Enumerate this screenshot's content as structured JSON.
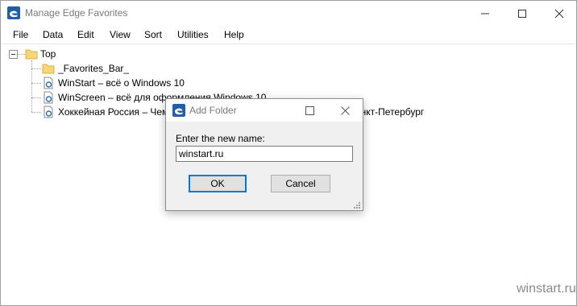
{
  "window": {
    "title": "Manage Edge Favorites"
  },
  "menu": [
    "File",
    "Data",
    "Edit",
    "View",
    "Sort",
    "Utilities",
    "Help"
  ],
  "tree": {
    "root": "Top",
    "children": [
      {
        "label": "_Favorites_Bar_",
        "type": "folder"
      },
      {
        "label": "WinStart – всё о Windows 10",
        "type": "link"
      },
      {
        "label": "WinScreen – всё для оформления Windows 10",
        "type": "link"
      },
      {
        "label": "Хоккейная Россия – Чемпионат мира по хоккею 2016 | Москва и Санкт-Петербург",
        "type": "link"
      }
    ]
  },
  "dialog": {
    "title": "Add Folder",
    "prompt": "Enter the new name:",
    "value": "winstart.ru",
    "ok_label": "OK",
    "cancel_label": "Cancel"
  },
  "watermark": "winstart.ru",
  "colors": {
    "default_button_border": "#0078d7",
    "folder": "#f7d774",
    "app_icon": "#1f5fa8"
  }
}
